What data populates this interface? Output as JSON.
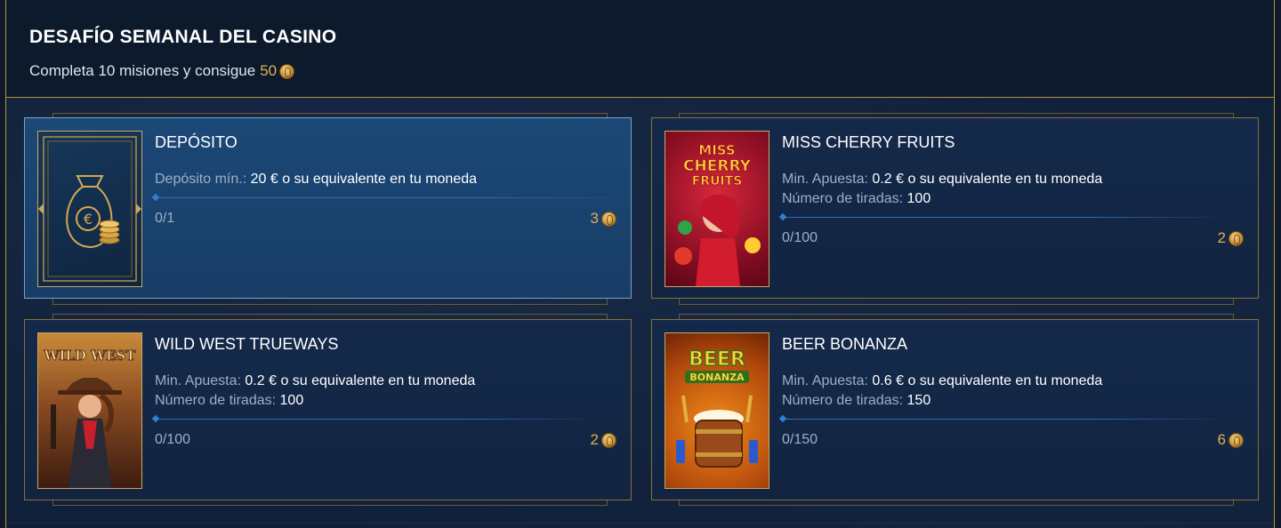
{
  "header": {
    "title": "DESAFÍO SEMANAL DEL CASINO",
    "subtitle": "Completa 10 misiones y consigue",
    "reward": "50"
  },
  "missions": [
    {
      "title": "DEPÓSITO",
      "line1_label": "Depósito mín.:",
      "line1_value": "20 € o su equivalente en tu moneda",
      "progress": "0/1",
      "reward": "3",
      "thumb_icon": "money-bag-euro-icon"
    },
    {
      "title": "MISS CHERRY FRUITS",
      "line1_label": "Min. Apuesta:",
      "line1_value": "0.2 € o su equivalente en tu moneda",
      "line2_label": "Número de tiradas:",
      "line2_value": "100",
      "progress": "0/100",
      "reward": "2",
      "thumb_text": [
        "MISS",
        "CHERRY",
        "FRUITS"
      ]
    },
    {
      "title": "WILD WEST TRUEWAYS",
      "line1_label": "Min. Apuesta:",
      "line1_value": "0.2 € o su equivalente en tu moneda",
      "line2_label": "Número de tiradas:",
      "line2_value": "100",
      "progress": "0/100",
      "reward": "2",
      "thumb_text": [
        "WILD WEST"
      ]
    },
    {
      "title": "BEER BONANZA",
      "line1_label": "Min. Apuesta:",
      "line1_value": "0.6 € o su equivalente en tu moneda",
      "line2_label": "Número de tiradas:",
      "line2_value": "150",
      "progress": "0/150",
      "reward": "6",
      "thumb_text": [
        "BEER",
        "BONANZA"
      ]
    }
  ],
  "colors": {
    "gold": "#e0b057",
    "active_card": "#1c4877",
    "card": "#14294a",
    "progress": "#2e6fb0"
  }
}
